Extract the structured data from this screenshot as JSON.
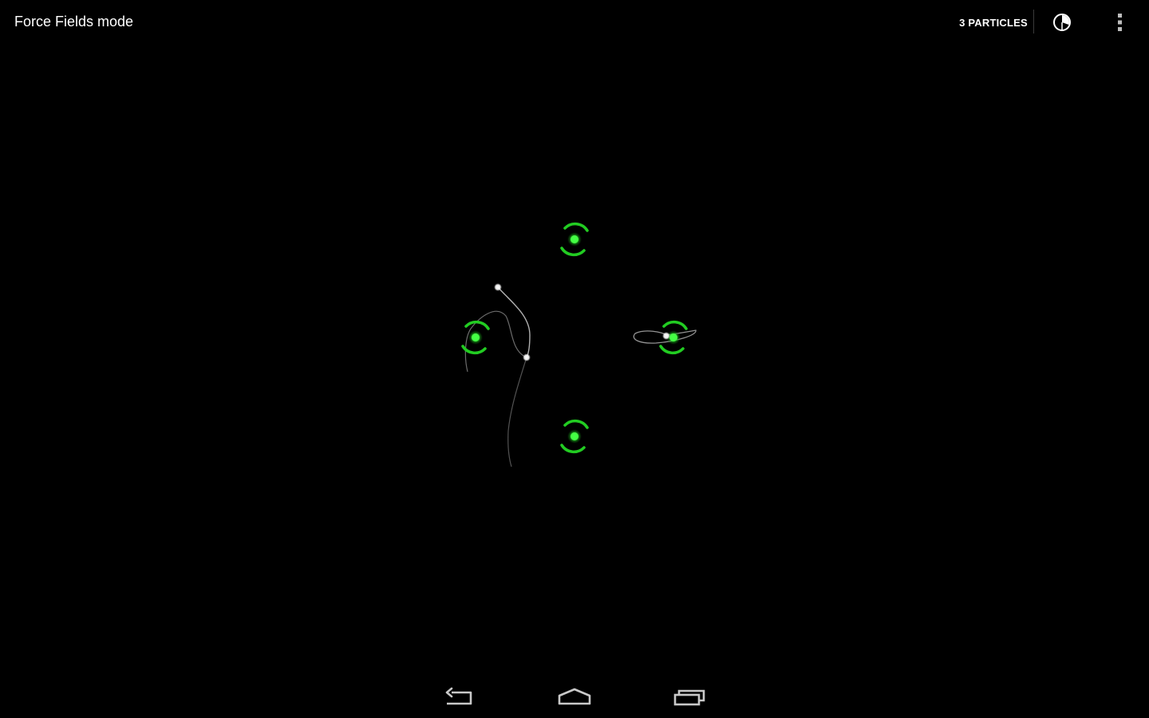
{
  "action_bar": {
    "title": "Force Fields mode",
    "particles_label": "3 PARTICLES",
    "timer_icon": "pie-timer-icon",
    "overflow_icon": "overflow-menu-icon"
  },
  "simulation": {
    "force_field_count": 4,
    "particle_count": 3,
    "field_color": "#22cc22",
    "field_core_color": "#33ff33",
    "particle_color": "#ffffff"
  },
  "nav_bar": {
    "back_icon": "back-icon",
    "home_icon": "home-icon",
    "recents_icon": "recent-apps-icon"
  },
  "colors": {
    "background": "#000000",
    "text": "#ffffff",
    "nav_icon": "#c8c8c8"
  }
}
